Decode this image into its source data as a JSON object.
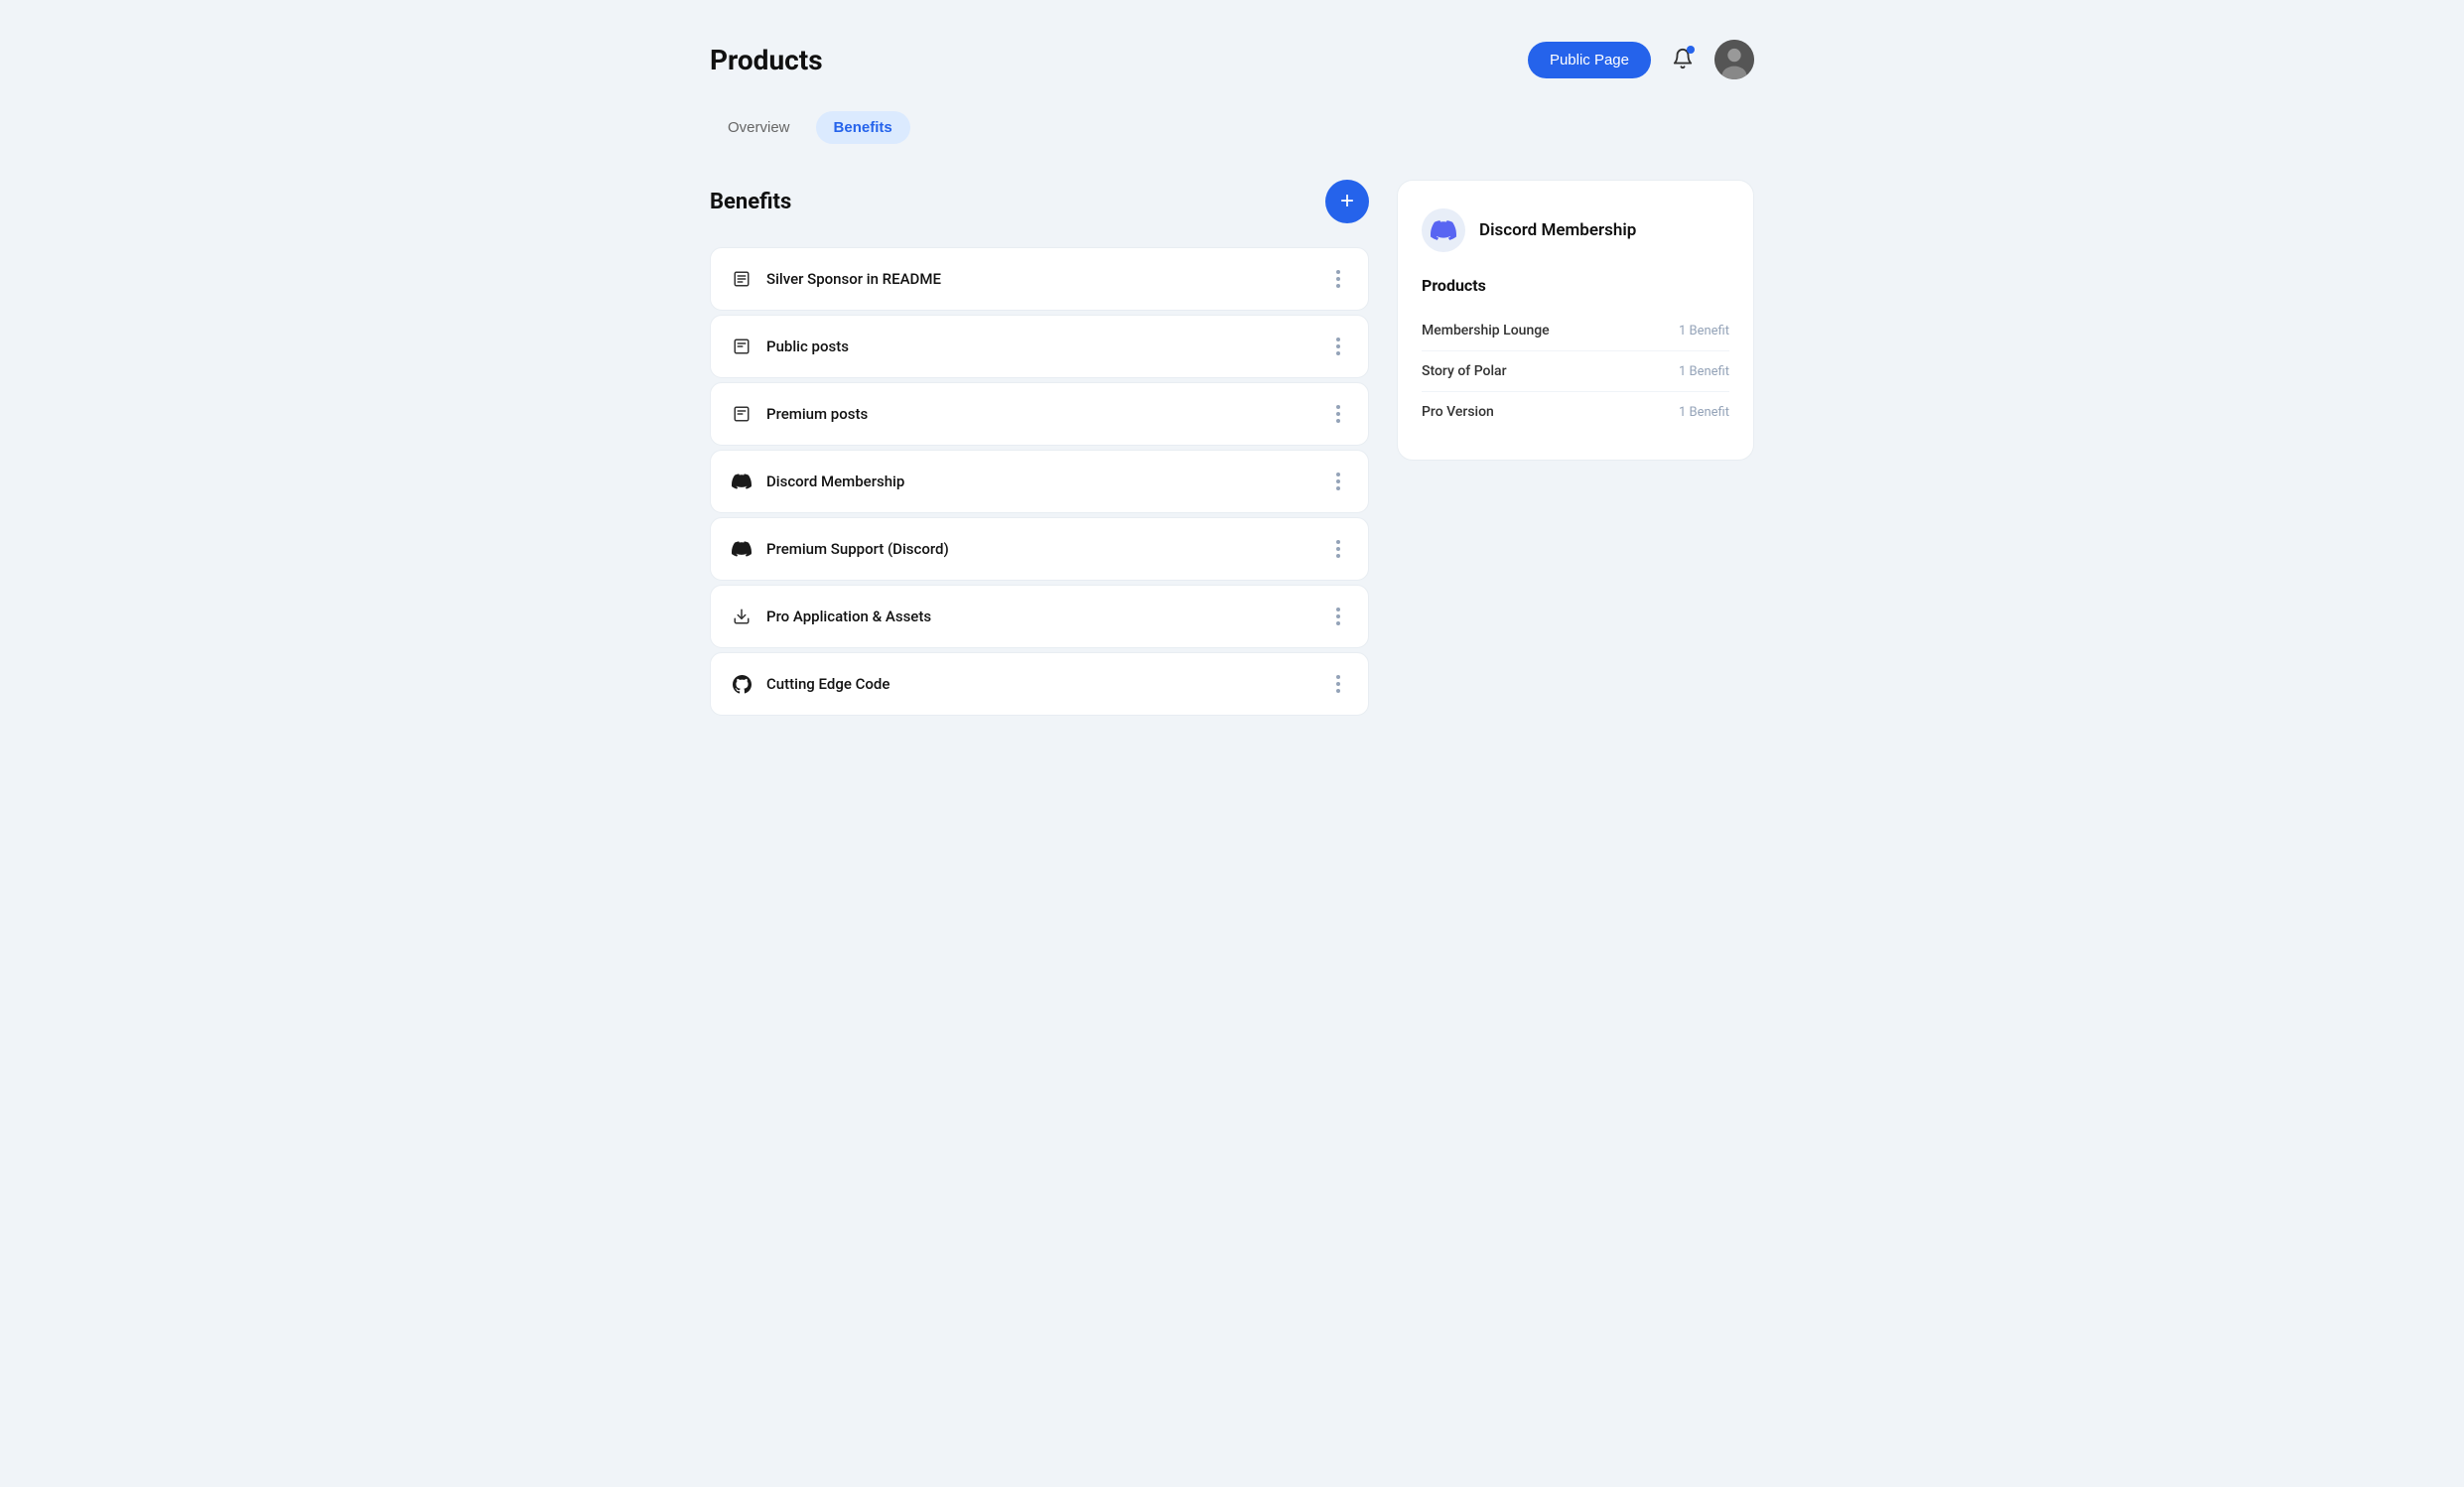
{
  "header": {
    "title": "Products",
    "public_page_btn": "Public Page"
  },
  "tabs": [
    {
      "id": "overview",
      "label": "Overview",
      "active": false
    },
    {
      "id": "benefits",
      "label": "Benefits",
      "active": true
    }
  ],
  "benefits": {
    "title": "Benefits",
    "add_btn_label": "+",
    "items": [
      {
        "id": "silver-sponsor",
        "name": "Silver Sponsor in README",
        "icon": "file-text"
      },
      {
        "id": "public-posts",
        "name": "Public posts",
        "icon": "article"
      },
      {
        "id": "premium-posts",
        "name": "Premium posts",
        "icon": "article"
      },
      {
        "id": "discord-membership",
        "name": "Discord Membership",
        "icon": "discord"
      },
      {
        "id": "premium-support",
        "name": "Premium Support (Discord)",
        "icon": "discord"
      },
      {
        "id": "pro-assets",
        "name": "Pro Application & Assets",
        "icon": "download"
      },
      {
        "id": "cutting-edge",
        "name": "Cutting Edge Code",
        "icon": "github"
      }
    ]
  },
  "discord_panel": {
    "title": "Discord Membership",
    "products_label": "Products",
    "products": [
      {
        "name": "Membership Lounge",
        "benefit": "1 Benefit"
      },
      {
        "name": "Story of Polar",
        "benefit": "1 Benefit"
      },
      {
        "name": "Pro Version",
        "benefit": "1 Benefit"
      }
    ]
  }
}
